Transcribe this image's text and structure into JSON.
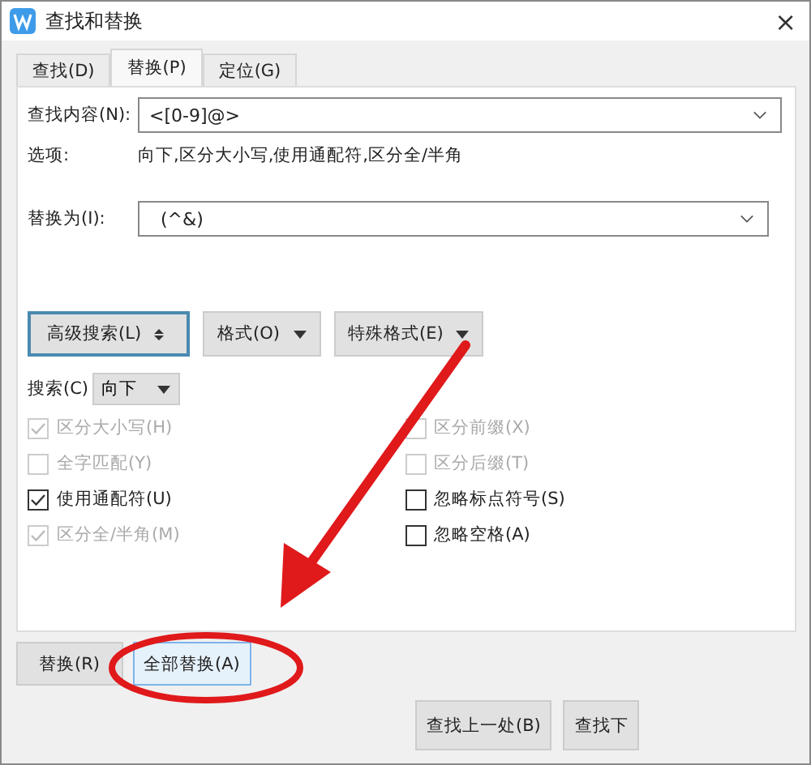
{
  "window": {
    "title": "查找和替换",
    "close": "×"
  },
  "tabs": [
    {
      "label": "查找(D)",
      "selected": false
    },
    {
      "label": "替换(P)",
      "selected": true
    },
    {
      "label": "定位(G)",
      "selected": false
    }
  ],
  "find": {
    "label": "查找内容(N):",
    "value": "<[0-9]@>"
  },
  "options": {
    "label": "选项:",
    "value": "向下,区分大小写,使用通配符,区分全/半角"
  },
  "replace": {
    "label": "替换为(I):",
    "value": "(^&)"
  },
  "tool_buttons": [
    {
      "label": "高级搜索(L)",
      "kind": "toggle",
      "selected": true
    },
    {
      "label": "格式(O)",
      "kind": "menu",
      "selected": false
    },
    {
      "label": "特殊格式(E)",
      "kind": "menu",
      "selected": false
    }
  ],
  "search": {
    "label": "搜索(C)",
    "value": "向下"
  },
  "checkboxes_left": [
    {
      "label": "区分大小写(H)",
      "checked": true,
      "disabled": true
    },
    {
      "label": "全字匹配(Y)",
      "checked": false,
      "disabled": true
    },
    {
      "label": "使用通配符(U)",
      "checked": true,
      "disabled": false
    },
    {
      "label": "区分全/半角(M)",
      "checked": true,
      "disabled": true
    }
  ],
  "checkboxes_right": [
    {
      "label": "区分前缀(X)",
      "checked": false,
      "disabled": true
    },
    {
      "label": "区分后缀(T)",
      "checked": false,
      "disabled": true
    },
    {
      "label": "忽略标点符号(S)",
      "checked": false,
      "disabled": false
    },
    {
      "label": "忽略空格(A)",
      "checked": false,
      "disabled": false
    }
  ],
  "replace_buttons": [
    {
      "label": "替换(R)",
      "selected": false
    },
    {
      "label": "全部替换(A)",
      "selected": true
    }
  ],
  "find_buttons": [
    "查找上一处(B)",
    "查找下"
  ]
}
